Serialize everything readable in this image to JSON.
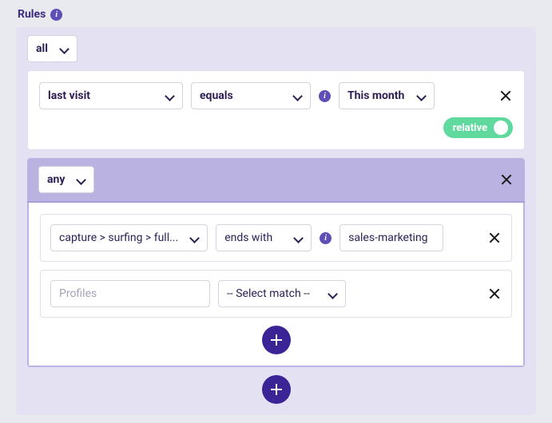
{
  "header": {
    "title": "Rules"
  },
  "group": {
    "combinator": "all",
    "rules": [
      {
        "field": "last visit",
        "operator": "equals",
        "value": "This month",
        "relative_label": "relative"
      }
    ],
    "sub_group": {
      "combinator": "any",
      "rules": [
        {
          "field": "capture > surfing > full...",
          "operator": "ends with",
          "value": "sales-marketing"
        },
        {
          "field_placeholder": "Profiles",
          "operator_placeholder": "-- Select match --"
        }
      ]
    }
  }
}
